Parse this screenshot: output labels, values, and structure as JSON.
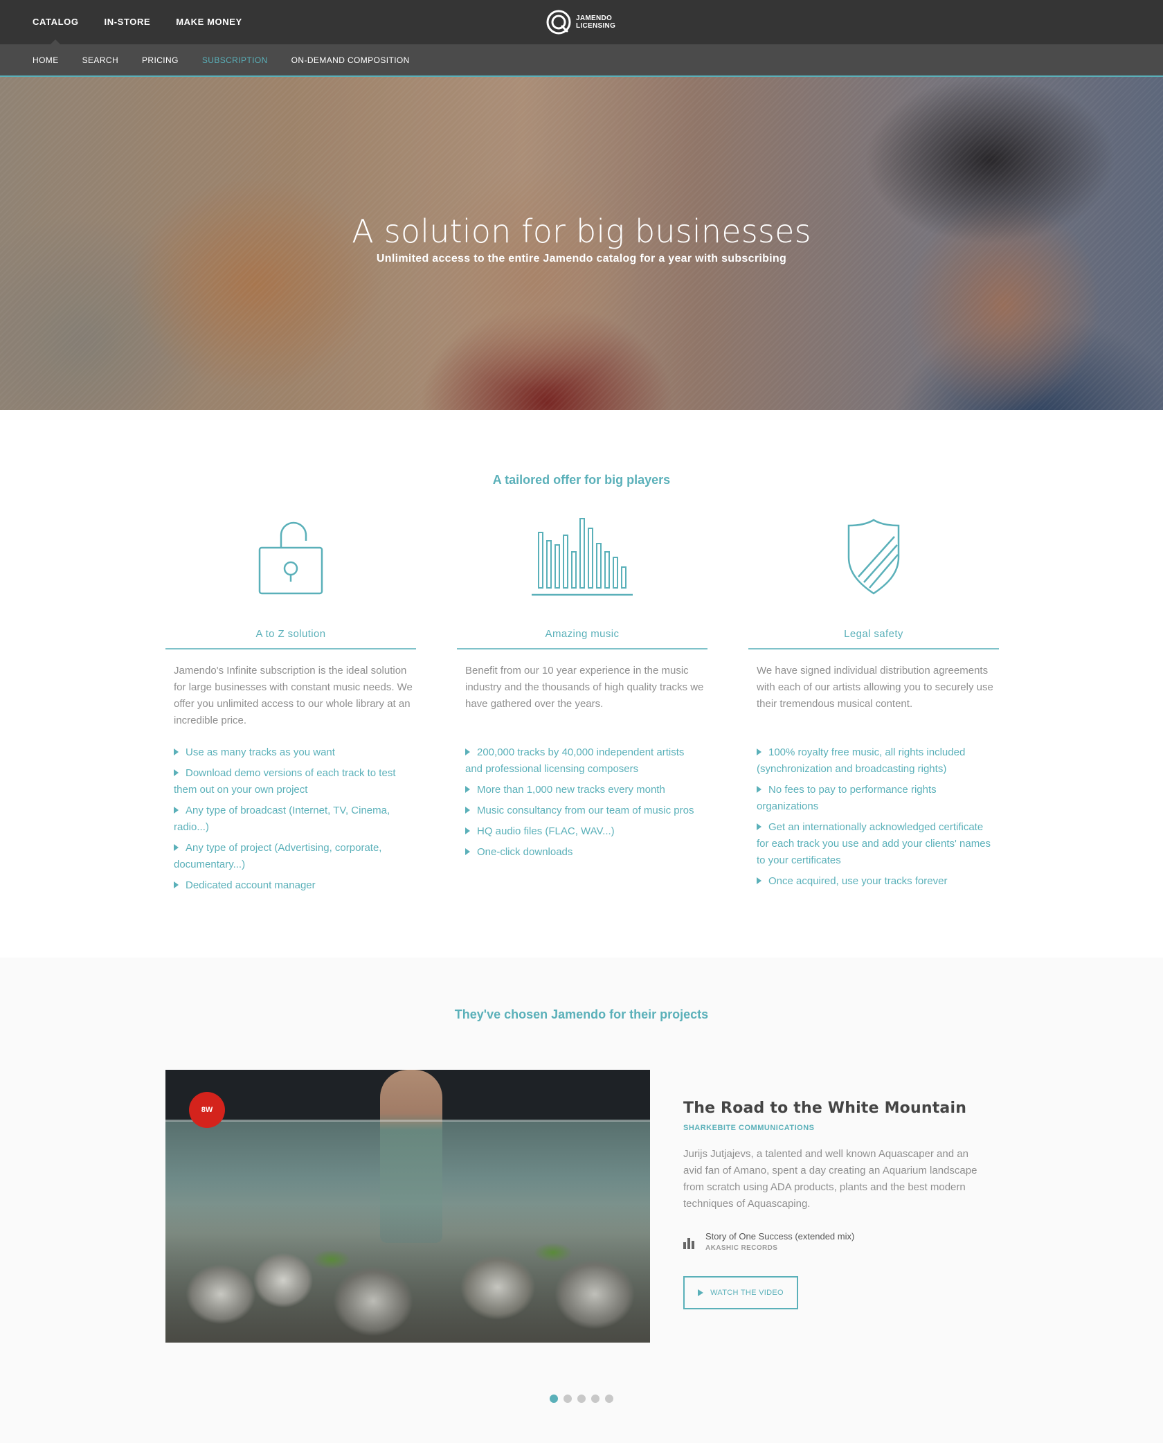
{
  "topnav": {
    "items": [
      {
        "label": "CATALOG",
        "active": true
      },
      {
        "label": "IN-STORE",
        "active": false
      },
      {
        "label": "MAKE MONEY",
        "active": false
      }
    ]
  },
  "logo": {
    "line1": "JAMENDO",
    "line2": "LICENSING"
  },
  "subnav": {
    "items": [
      {
        "label": "HOME"
      },
      {
        "label": "SEARCH"
      },
      {
        "label": "PRICING"
      },
      {
        "label": "SUBSCRIPTION"
      },
      {
        "label": "ON-DEMAND COMPOSITION"
      }
    ],
    "active_index": 3
  },
  "hero": {
    "title": "A solution for big businesses",
    "subtitle": "Unlimited access to the entire Jamendo catalog for a year with subscribing"
  },
  "offer": {
    "title": "A tailored offer for big players",
    "columns": [
      {
        "icon": "unlock-icon",
        "heading": "A to Z solution",
        "description": "Jamendo's Infinite subscription is the ideal solution for large businesses with constant music needs. We offer you unlimited access to our whole library at an incredible price.",
        "bullets": [
          "Use as many tracks as you want",
          "Download demo versions of each track to test them out on your own project",
          "Any type of broadcast (Internet, TV, Cinema, radio...)",
          "Any type of project (Advertising, corporate, documentary...)",
          "Dedicated account manager"
        ]
      },
      {
        "icon": "bar-chart-icon",
        "heading": "Amazing music",
        "description": "Benefit from our 10 year experience in the music industry and the thousands of high quality tracks we have gathered over the years.",
        "bullets": [
          "200,000 tracks by 40,000 independent artists and professional licensing composers",
          "More than 1,000 new tracks every month",
          "Music consultancy from our team of music pros",
          "HQ audio files (FLAC, WAV...)",
          "One-click downloads"
        ]
      },
      {
        "icon": "shield-icon",
        "heading": "Legal safety",
        "description": "We have signed individual distribution agreements with each of our artists allowing you to securely use their tremendous musical content.",
        "bullets": [
          "100% royalty free music, all rights included (synchronization and broadcasting rights)",
          "No fees to pay to performance rights organizations",
          "Get an internationally acknowledged certificate for each track you use and add your clients' names to your certificates",
          "Once acquired, use your tracks forever"
        ]
      }
    ]
  },
  "projects": {
    "title": "They've chosen Jamendo for their projects",
    "badge_text": "8W",
    "item": {
      "title": "The Road to the White Mountain",
      "client": "SHARKEBITE COMMUNICATIONS",
      "description": "Jurijs Jutjajevs, a talented and well known Aquascaper and an avid fan of Amano, spent a day creating an Aquarium landscape from scratch using ADA products, plants and the best modern techniques of Aquascaping.",
      "track_name": "Story of One Success (extended mix)",
      "track_label": "AKASHIC RECORDS",
      "button_label": "WATCH THE VIDEO"
    },
    "carousel": {
      "count": 5,
      "active_index": 0
    }
  },
  "colors": {
    "accent": "#5ab0b9",
    "topbar": "#353535",
    "subnav": "#4b4b4b"
  }
}
